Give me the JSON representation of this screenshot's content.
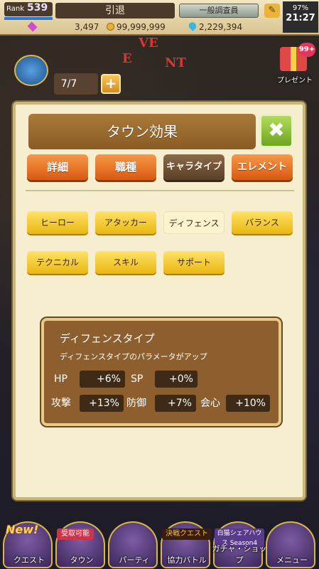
{
  "status": {
    "rank_label": "Rank",
    "rank_value": "539",
    "player_name": "引退",
    "title_badge": "一般調査員",
    "battery": "97%",
    "time": "21:27",
    "gems": "3,497",
    "coins": "99,999,999",
    "drops": "2,229,394"
  },
  "event": {
    "letters": [
      "VE",
      "E",
      "NT"
    ]
  },
  "stamina": {
    "value": "7/7",
    "plus": "+"
  },
  "present": {
    "badge": "99+",
    "label": "プレゼント"
  },
  "modal": {
    "title": "タウン効果",
    "close": "✖",
    "tabs": [
      {
        "label": "詳細"
      },
      {
        "label": "職種"
      },
      {
        "label": "キャラタイプ",
        "selected": true
      },
      {
        "label": "エレメント"
      }
    ],
    "types": [
      {
        "label": "ヒーロー"
      },
      {
        "label": "アタッカー"
      },
      {
        "label": "ディフェンス",
        "selected": true
      },
      {
        "label": "バランス"
      },
      {
        "label": "テクニカル"
      },
      {
        "label": "スキル"
      },
      {
        "label": "サポート"
      }
    ],
    "info": {
      "title": "ディフェンスタイプ",
      "description": "ディフェンスタイプのパラメータがアップ",
      "stats": [
        {
          "label": "HP",
          "value": "+6%"
        },
        {
          "label": "SP",
          "value": "+0%"
        },
        {
          "label": "攻撃",
          "value": "+13%"
        },
        {
          "label": "防御",
          "value": "+7%"
        },
        {
          "label": "会心",
          "value": "+10%"
        }
      ]
    }
  },
  "nav": {
    "items": [
      {
        "label": "クエスト",
        "badge": "New!"
      },
      {
        "label": "タウン",
        "badge": "受取可能"
      },
      {
        "label": "パーティ"
      },
      {
        "label": "協力バトル",
        "badge": "決戦クエスト"
      },
      {
        "label": "ガチャ・ショップ",
        "badge": "白猫シェアハウス Season4"
      },
      {
        "label": "メニュー"
      }
    ]
  },
  "colors": {
    "accent_orange": "#d85a12",
    "close_green": "#6ea521",
    "option_yellow": "#e9b712",
    "panel_brown": "#8d5f2f"
  }
}
